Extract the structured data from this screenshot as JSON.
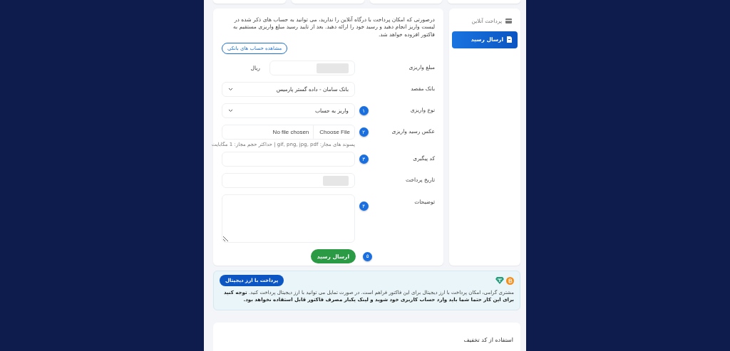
{
  "form": {
    "intro": "درصورتی که امکان پرداخت با درگاه آنلاین را ندارید، می توانید به حساب های ذکر شده در لیست واریز انجام دهید و رسید خود را ارائه دهید. بعد از تایید رسید مبلغ واریزی مستقیم به فاکتور افزوده خواهد شد.",
    "accounts_button": "مشاهده حساب های بانکی",
    "fields": [
      {
        "kind": "amount",
        "label": "مبلغ واریزی",
        "unit": "ریال",
        "blurred": true
      },
      {
        "kind": "select",
        "label": "بانک مقصد",
        "value": "بانک سامان - داده گستر پارمیس"
      },
      {
        "kind": "select",
        "label": "نوع واریزی",
        "value": "واریز به حساب",
        "step": "۱"
      },
      {
        "kind": "file",
        "label": "عکس رسید واریزی",
        "button": "Choose File",
        "value": "No file chosen",
        "hint": "پسوند های مجاز: gif, png, jpg, pdf | حداکثر حجم مجاز: 1 مگابایت",
        "step": "۲"
      },
      {
        "kind": "text",
        "label": "کد پیگیری",
        "step": "۳"
      },
      {
        "kind": "text",
        "label": "تاریخ پرداخت",
        "blurred": true
      },
      {
        "kind": "textarea",
        "label": "توضیحات",
        "step": "۴"
      }
    ],
    "submit": {
      "label": "ارسال رسید",
      "step": "۵"
    }
  },
  "sidebar": {
    "items": [
      {
        "label": "پرداخت آنلاین",
        "selected": false
      },
      {
        "label": "ارسال رسید",
        "selected": true
      }
    ]
  },
  "crypto": {
    "button": "پرداخت با ارز دیجیتال",
    "text": "مشتری گرامی، امکان پرداخت با ارز دیجیتال برای این فاکتور فراهم است. در صورت تمایل می توانید با ارز دیجیتال پرداخت کنید. **توجه کنید برای این کار حتما شما باید وارد حساب کاربری خود شوید و لینک یکبار مصرف فاکتور قابل استفاده نخواهد بود.**"
  },
  "discount": {
    "title": "استفاده از کد تخفیف"
  }
}
